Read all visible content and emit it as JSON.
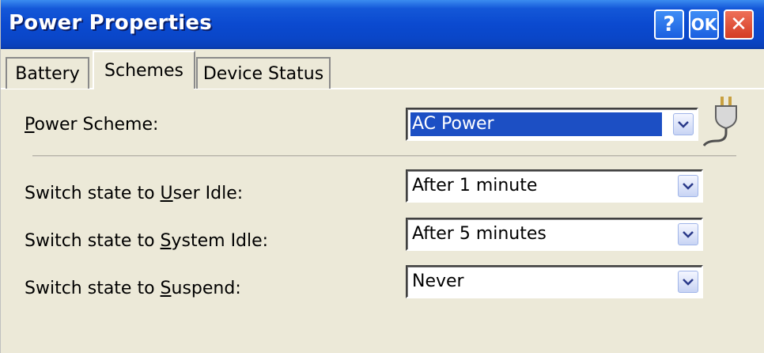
{
  "window": {
    "title": "Power Properties",
    "help_label": "?",
    "ok_label": "OK",
    "close_label": "✕"
  },
  "tabs": [
    {
      "label": "Battery",
      "selected": false
    },
    {
      "label": "Schemes",
      "selected": true
    },
    {
      "label": "Device Status",
      "selected": false
    }
  ],
  "power_scheme": {
    "label_pre": "",
    "label_mnemonic": "P",
    "label_post": "ower Scheme:",
    "value": "AC Power"
  },
  "settings": [
    {
      "label_pre": "Switch state to ",
      "mnemonic": "U",
      "label_post": "ser Idle:",
      "value": "After 1 minute"
    },
    {
      "label_pre": "Switch state to ",
      "mnemonic": "S",
      "label_post": "ystem Idle:",
      "value": "After 5 minutes"
    },
    {
      "label_pre": "Switch state to ",
      "mnemonic": "S",
      "label_post": "uspend:",
      "value": "Never"
    }
  ],
  "icons": {
    "plug": "ac-plug-icon",
    "dropdown": "chevron-down-icon"
  },
  "colors": {
    "titlebar": "#0b4ad0",
    "selection": "#1c4fc4",
    "close": "#d43c24"
  }
}
